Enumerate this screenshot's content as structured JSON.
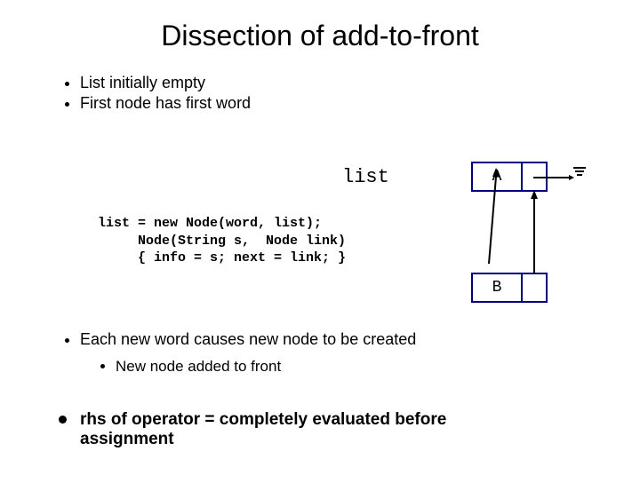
{
  "title": "Dissection of add-to-front",
  "bullet1": "List initially empty",
  "bullet2": "First node has first word",
  "listLabel": "list",
  "nodeA": "A",
  "nodeB": "B",
  "code": "list = new Node(word, list);\n     Node(String s,  Node link)\n     { info = s; next = link; }",
  "bullet3": "Each new word causes new node to be created",
  "bullet3sub": "New node added to front",
  "bullet4": "rhs of operator = completely evaluated before assignment"
}
